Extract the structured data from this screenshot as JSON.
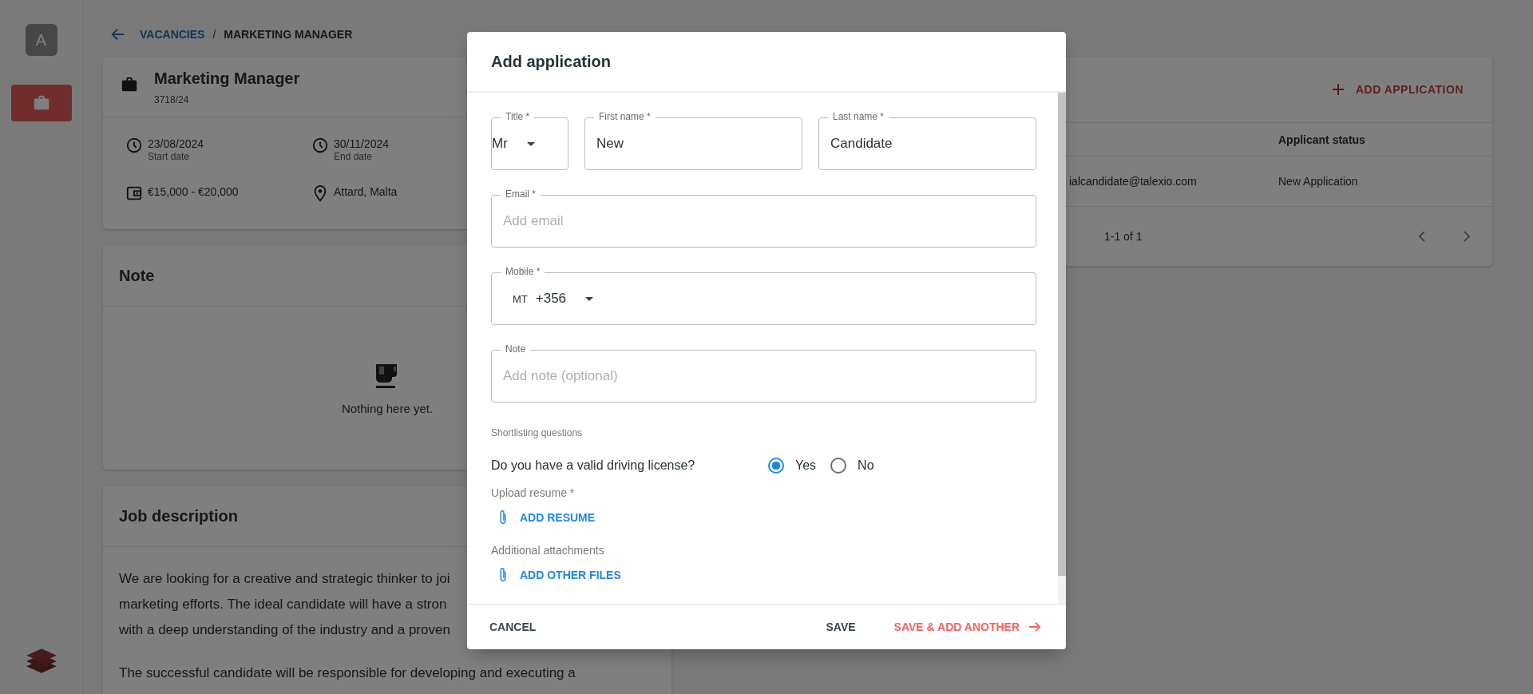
{
  "sidebar": {
    "avatar": "A",
    "items": [
      {
        "selected": true
      }
    ]
  },
  "breadcrumb": {
    "link": "VACANCIES",
    "separator": "/",
    "current": "MARKETING MANAGER"
  },
  "vacancy": {
    "title": "Marketing Manager",
    "code": "3718/24",
    "details": [
      {
        "kind": "clock",
        "value": "23/08/2024",
        "label": "Start date"
      },
      {
        "kind": "clock",
        "value": "30/11/2024",
        "label": "End date"
      },
      {
        "kind": "wallet",
        "value": "€15,000 - €20,000"
      },
      {
        "kind": "pin",
        "value": "Attard, Malta"
      }
    ]
  },
  "note_card": {
    "title": "Note",
    "empty_text": "Nothing here yet."
  },
  "job_description": {
    "title": "Job description",
    "paragraphs": [
      {
        "lines": [
          "We are looking for a creative and strategic thinker to joi",
          "marketing efforts. The ideal candidate will have a stron",
          "with a deep understanding of the industry and a proven"
        ]
      },
      {
        "lines": [
          "The successful candidate will be responsible for developing and executing a"
        ]
      }
    ]
  },
  "applications": {
    "add_button": "ADD APPLICATION",
    "column_header": "Applicant status",
    "rows": [
      {
        "email": "ialcandidate@talexio.com",
        "status": "New Application"
      }
    ],
    "pagination": "1-1 of 1"
  },
  "dialog": {
    "title": "Add application",
    "field_rows": [
      {
        "fields": [
          {
            "kind": "select",
            "label": "Title *",
            "value": "Mr"
          },
          {
            "kind": "text",
            "label": "First name *",
            "value": "New"
          },
          {
            "kind": "text",
            "label": "Last name *",
            "value": "Candidate"
          }
        ]
      },
      {
        "fields": [
          {
            "kind": "text",
            "label": "Email *",
            "placeholder": "Add email"
          }
        ]
      },
      {
        "fields": [
          {
            "kind": "phone",
            "label": "Mobile *",
            "country": "MT",
            "value": "+356"
          }
        ]
      },
      {
        "fields": [
          {
            "kind": "text",
            "label": "Note",
            "placeholder": "Add note (optional)"
          }
        ]
      }
    ],
    "section_title": "Shortlisting questions",
    "questions": [
      {
        "text": "Do you have a valid driving license?",
        "options": [
          {
            "label": "Yes",
            "selected": true
          },
          {
            "label": "No",
            "selected": false
          }
        ]
      }
    ],
    "uploads": [
      {
        "label": "Upload resume *",
        "button": "ADD RESUME"
      },
      {
        "label": "Additional attachments",
        "button": "ADD OTHER FILES"
      }
    ],
    "cancel": "CANCEL",
    "save": "SAVE",
    "save_another": "SAVE & ADD ANOTHER"
  }
}
